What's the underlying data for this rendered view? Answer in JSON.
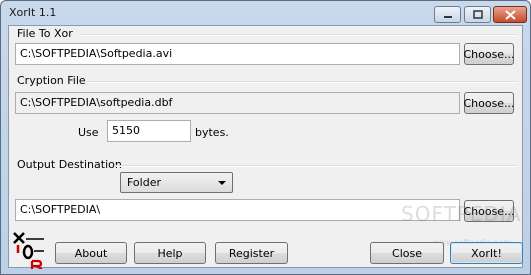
{
  "window": {
    "title": "XorIt 1.1"
  },
  "file_to_xor": {
    "label": "File To Xor",
    "value": "C:\\SOFTPEDIA\\Softpedia.avi",
    "choose": "Choose..."
  },
  "cryption_file": {
    "label": "Cryption File",
    "value": "C:\\SOFTPEDIA\\softpedia.dbf",
    "choose": "Choose..."
  },
  "use": {
    "label": "Use",
    "value": "5150",
    "unit": "bytes."
  },
  "output": {
    "label": "Output Destination",
    "type_selected": "Folder",
    "value": "C:\\SOFTPEDIA\\",
    "choose": "Choose..."
  },
  "buttons": {
    "about": "About",
    "help": "Help",
    "register": "Register",
    "close": "Close",
    "xorit": "XorIt!"
  },
  "watermark": {
    "text": "SOFTPEDIA",
    "sub": "www.softpedia.com"
  },
  "icons": {
    "minimize": "minimize-icon",
    "maximize": "maximize-icon",
    "close": "close-icon",
    "logo": "xor-logo-icon"
  }
}
